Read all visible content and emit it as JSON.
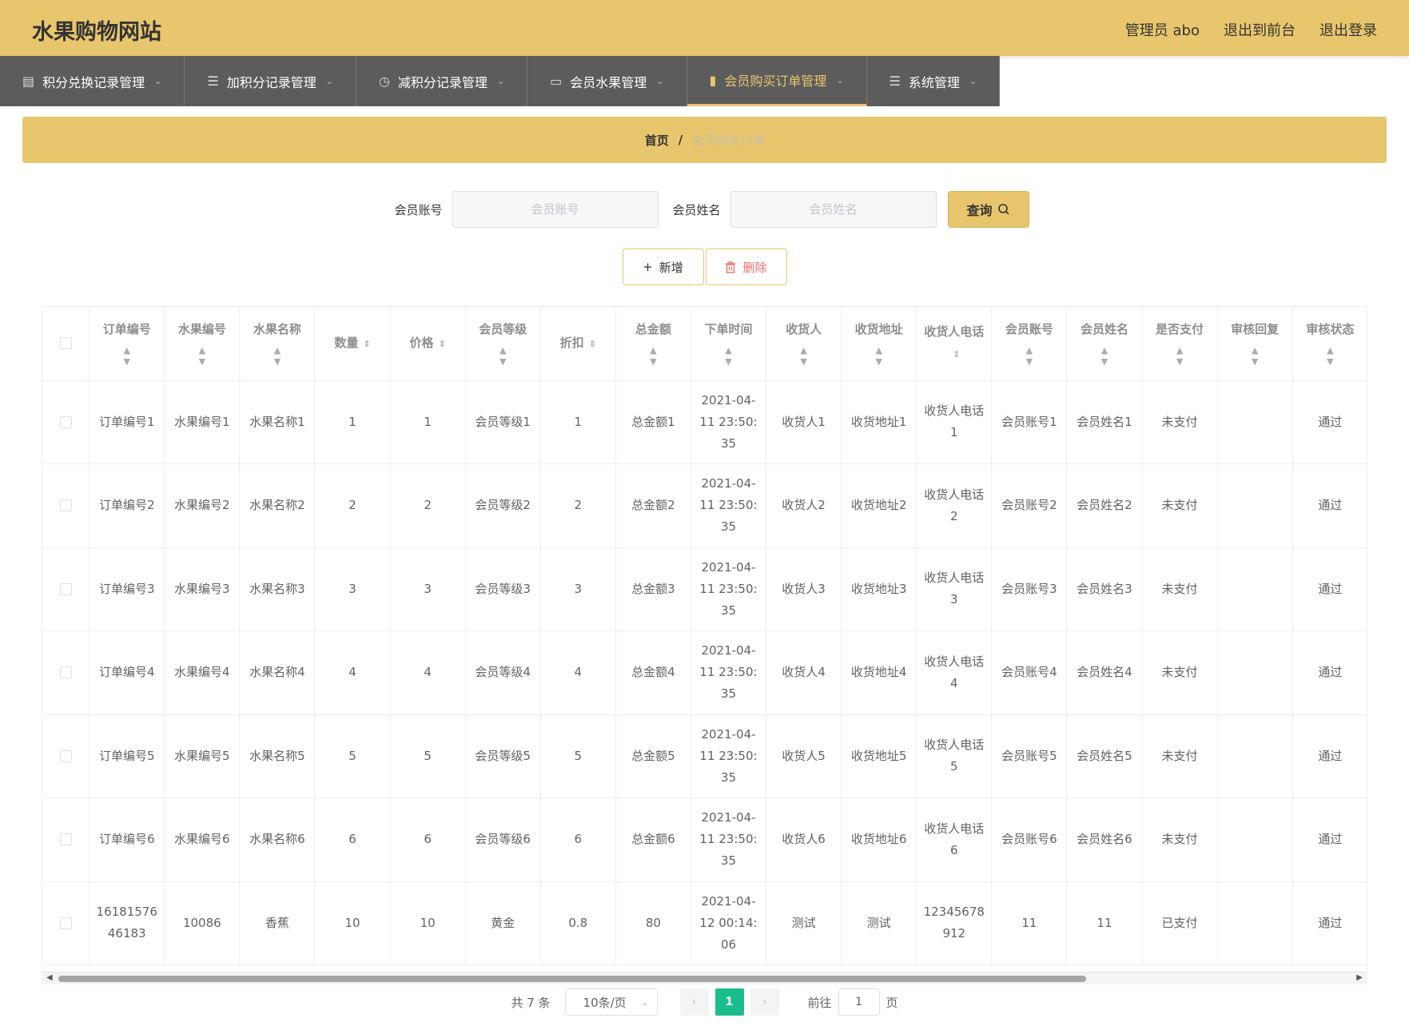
{
  "header": {
    "title": "水果购物网站",
    "admin_label": "管理员 abo",
    "to_front_label": "退出到前台",
    "logout_label": "退出登录"
  },
  "nav": {
    "items": [
      {
        "label": "积分兑换记录管理",
        "icon": "card-icon"
      },
      {
        "label": "加积分记录管理",
        "icon": "list-icon"
      },
      {
        "label": "减积分记录管理",
        "icon": "clock-icon"
      },
      {
        "label": "会员水果管理",
        "icon": "chat-icon"
      },
      {
        "label": "会员购买订单管理",
        "icon": "book-icon"
      },
      {
        "label": "系统管理",
        "icon": "list-icon"
      }
    ],
    "active_index": 4
  },
  "breadcrumb": {
    "home": "首页",
    "separator": "/",
    "current": "会员购买订单"
  },
  "search": {
    "account_label": "会员账号",
    "account_placeholder": "会员账号",
    "name_label": "会员姓名",
    "name_placeholder": "会员姓名",
    "query_label": "查询"
  },
  "actions": {
    "add_label": "新增",
    "delete_label": "删除"
  },
  "table": {
    "headers": [
      "订单编号",
      "水果编号",
      "水果名称",
      "数量",
      "价格",
      "会员等级",
      "折扣",
      "总金额",
      "下单时间",
      "收货人",
      "收货地址",
      "收货人电话",
      "会员账号",
      "会员姓名",
      "是否支付",
      "审核回复",
      "审核状态"
    ],
    "rows": [
      [
        "订单编号1",
        "水果编号1",
        "水果名称1",
        "1",
        "1",
        "会员等级1",
        "1",
        "总金额1",
        "2021-04-11 23:50:35",
        "收货人1",
        "收货地址1",
        "收货人电话1",
        "会员账号1",
        "会员姓名1",
        "未支付",
        "",
        "通过"
      ],
      [
        "订单编号2",
        "水果编号2",
        "水果名称2",
        "2",
        "2",
        "会员等级2",
        "2",
        "总金额2",
        "2021-04-11 23:50:35",
        "收货人2",
        "收货地址2",
        "收货人电话2",
        "会员账号2",
        "会员姓名2",
        "未支付",
        "",
        "通过"
      ],
      [
        "订单编号3",
        "水果编号3",
        "水果名称3",
        "3",
        "3",
        "会员等级3",
        "3",
        "总金额3",
        "2021-04-11 23:50:35",
        "收货人3",
        "收货地址3",
        "收货人电话3",
        "会员账号3",
        "会员姓名3",
        "未支付",
        "",
        "通过"
      ],
      [
        "订单编号4",
        "水果编号4",
        "水果名称4",
        "4",
        "4",
        "会员等级4",
        "4",
        "总金额4",
        "2021-04-11 23:50:35",
        "收货人4",
        "收货地址4",
        "收货人电话4",
        "会员账号4",
        "会员姓名4",
        "未支付",
        "",
        "通过"
      ],
      [
        "订单编号5",
        "水果编号5",
        "水果名称5",
        "5",
        "5",
        "会员等级5",
        "5",
        "总金额5",
        "2021-04-11 23:50:35",
        "收货人5",
        "收货地址5",
        "收货人电话5",
        "会员账号5",
        "会员姓名5",
        "未支付",
        "",
        "通过"
      ],
      [
        "订单编号6",
        "水果编号6",
        "水果名称6",
        "6",
        "6",
        "会员等级6",
        "6",
        "总金额6",
        "2021-04-11 23:50:35",
        "收货人6",
        "收货地址6",
        "收货人电话6",
        "会员账号6",
        "会员姓名6",
        "未支付",
        "",
        "通过"
      ],
      [
        "1618157646183",
        "10086",
        "香蕉",
        "10",
        "10",
        "黄金",
        "0.8",
        "80",
        "2021-04-12 00:14:06",
        "测试",
        "测试",
        "12345678912",
        "11",
        "11",
        "已支付",
        "",
        "通过"
      ]
    ]
  },
  "pagination": {
    "total": "共 7 条",
    "page_size": "10条/页",
    "current_page": "1",
    "goto_prefix": "前往",
    "goto_value": "1",
    "goto_suffix": "页"
  },
  "colors": {
    "accent": "#e8c66d",
    "nav_bg": "#5c5c5c",
    "page_active": "#19be8c",
    "danger": "#f56c6c"
  }
}
